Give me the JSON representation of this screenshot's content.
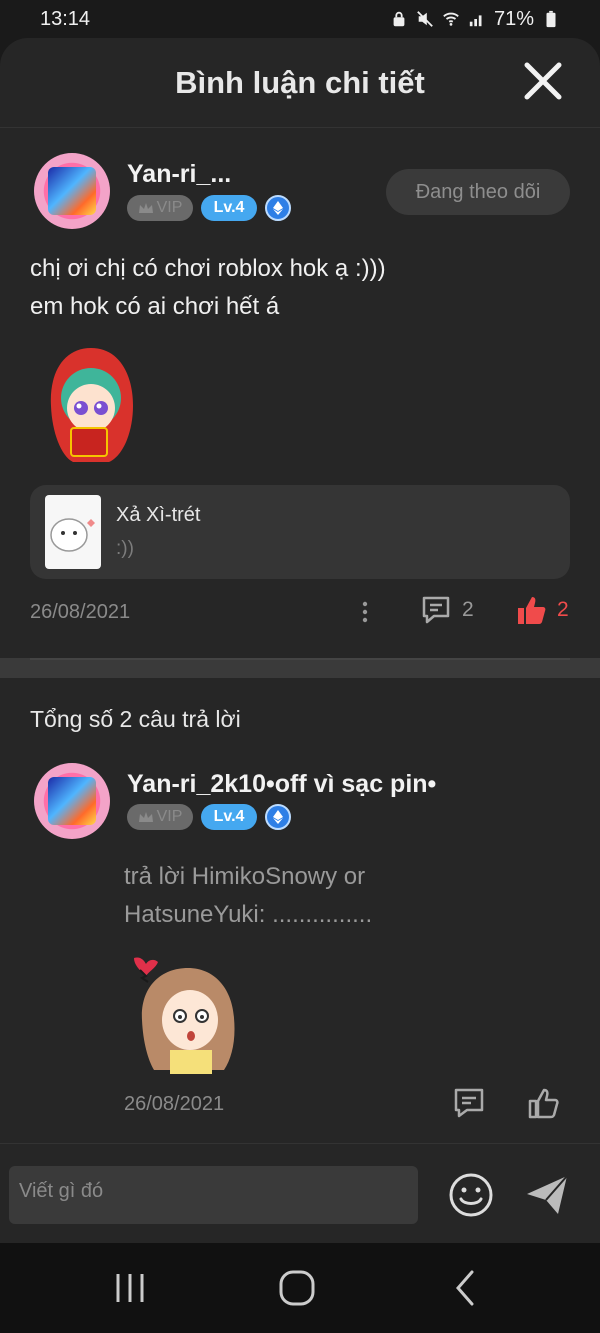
{
  "status_bar": {
    "time": "13:14",
    "battery": "71%"
  },
  "header": {
    "title": "Bình luận chi tiết"
  },
  "comment": {
    "username": "Yan-ri_...",
    "vip_label": "VIP",
    "level_label": "Lv.4",
    "follow_label": "Đang theo dõi",
    "text_line1": "chị ơi chị có chơi roblox hok ạ :)))",
    "text_line2": "em hok có ai chơi hết á",
    "quote_title": "Xả Xì-trét",
    "quote_sub": ":))",
    "date": "26/08/2021",
    "reply_count": "2",
    "like_count": "2"
  },
  "replies": {
    "total_label": "Tổng số 2 câu trả lời",
    "items": [
      {
        "username": "Yan-ri_2k10•off vì sạc pin•",
        "vip_label": "VIP",
        "level_label": "Lv.4",
        "text_line1": "trả lời HimikoSnowy or",
        "text_line2": "HatsuneYuki: ...............",
        "date": "26/08/2021"
      }
    ]
  },
  "composer": {
    "placeholder": "Viết gì đó"
  },
  "colors": {
    "accent_like": "#f04b4b",
    "level_badge": "#45a8f0",
    "sheet_bg": "#262626"
  }
}
